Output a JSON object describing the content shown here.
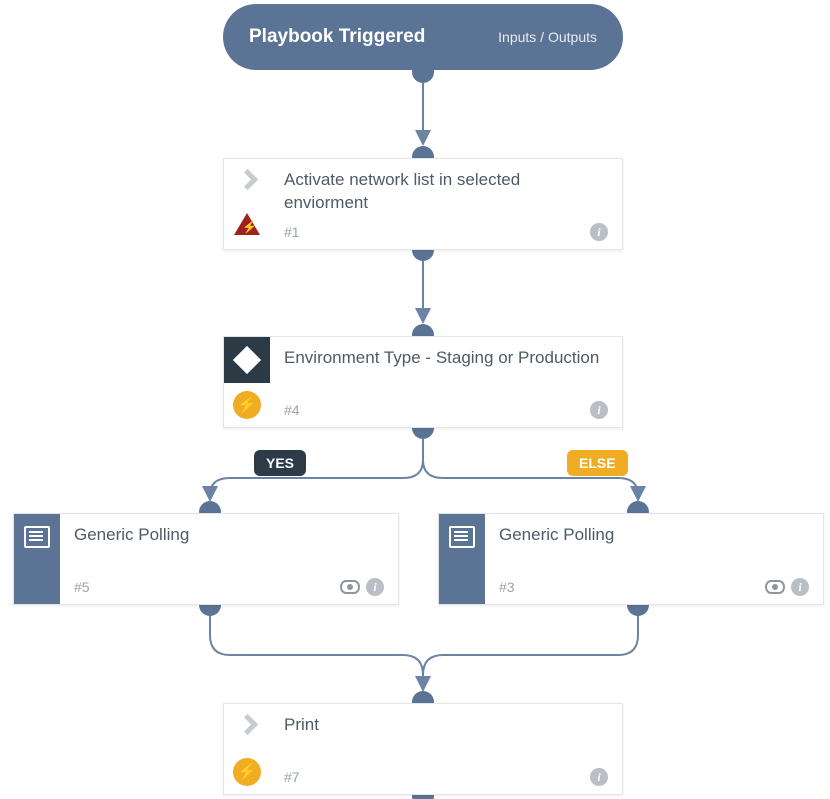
{
  "trigger": {
    "title": "Playbook Triggered",
    "io_label": "Inputs / Outputs"
  },
  "nodes": {
    "activate": {
      "title": "Activate network list in selected enviorment",
      "number": "#1"
    },
    "envtype": {
      "title": "Environment Type - Staging or Production",
      "number": "#4"
    },
    "poll_yes": {
      "title": "Generic Polling",
      "number": "#5"
    },
    "poll_else": {
      "title": "Generic Polling",
      "number": "#3"
    },
    "print": {
      "title": "Print",
      "number": "#7"
    }
  },
  "branches": {
    "yes": "YES",
    "else": "ELSE"
  }
}
